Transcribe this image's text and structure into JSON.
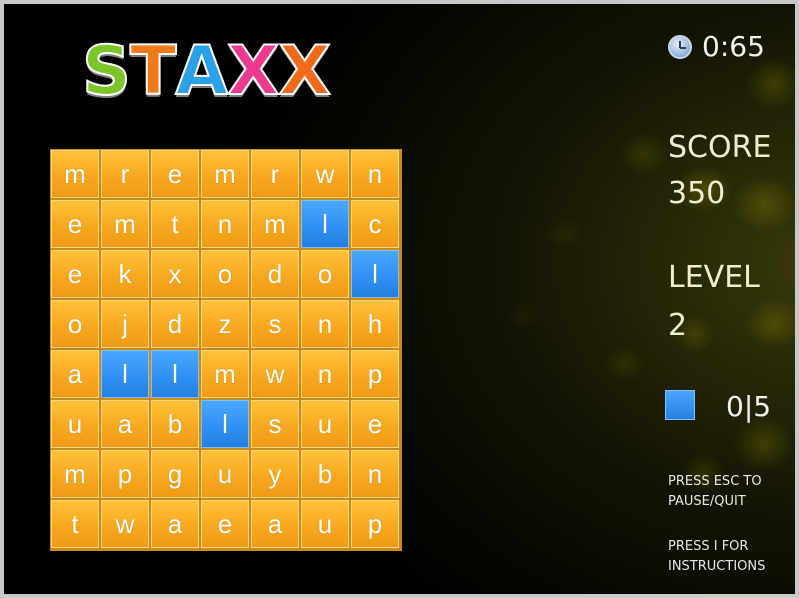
{
  "logo": {
    "letters": [
      "S",
      "T",
      "A",
      "X",
      "X"
    ],
    "colors": [
      "#7cc62a",
      "#f07a1a",
      "#2aa0e8",
      "#ee3a8c",
      "#f06a1a"
    ]
  },
  "timer": {
    "icon": "clock-icon",
    "value": "0:65"
  },
  "score": {
    "label": "SCORE",
    "value": "350"
  },
  "level": {
    "label": "LEVEL",
    "value": "2"
  },
  "goal": {
    "icon": "blue-tile-icon",
    "count": "0|5",
    "color": "#2f8ff2"
  },
  "hints": {
    "pause": "PRESS ESC TO PAUSE/QUIT",
    "instructions": "PRESS I FOR INSTRUCTIONS"
  },
  "board": {
    "rows": [
      [
        "m",
        "r",
        "e",
        "m",
        "r",
        "w",
        "n"
      ],
      [
        "e",
        "m",
        "t",
        "n",
        "m",
        "l",
        "c"
      ],
      [
        "e",
        "k",
        "x",
        "o",
        "d",
        "o",
        "l"
      ],
      [
        "o",
        "j",
        "d",
        "z",
        "s",
        "n",
        "h"
      ],
      [
        "a",
        "l",
        "l",
        "m",
        "w",
        "n",
        "p"
      ],
      [
        "u",
        "a",
        "b",
        "l",
        "s",
        "u",
        "e"
      ],
      [
        "m",
        "p",
        "g",
        "u",
        "y",
        "b",
        "n"
      ],
      [
        "t",
        "w",
        "a",
        "e",
        "a",
        "u",
        "p"
      ]
    ],
    "blue_tiles": [
      [
        1,
        5
      ],
      [
        2,
        6
      ],
      [
        4,
        1
      ],
      [
        4,
        2
      ],
      [
        5,
        3
      ]
    ],
    "tile_color": "#f7a81f",
    "blue_color": "#2f8ff2"
  }
}
